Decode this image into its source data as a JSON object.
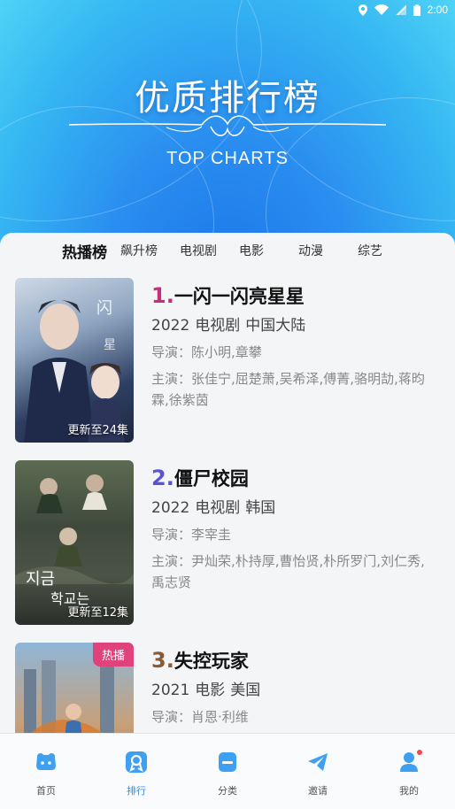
{
  "status": {
    "time": "2:00"
  },
  "hero": {
    "title": "优质排行榜",
    "subtitle": "TOP CHARTS"
  },
  "tabs": [
    {
      "label": "热播榜",
      "active": true
    },
    {
      "label": "飙升榜",
      "active": false
    },
    {
      "label": "电视剧",
      "active": false
    },
    {
      "label": "电影",
      "active": false
    },
    {
      "label": "动漫",
      "active": false
    },
    {
      "label": "综艺",
      "active": false
    }
  ],
  "items": [
    {
      "rank": "1.",
      "rank_color": "#c62f7e",
      "title": "一闪一闪亮星星",
      "year": "2022",
      "type": "电视剧",
      "region": "中国大陆",
      "director": "导演：陈小明,章攀",
      "cast": "主演：张佳宁,屈楚萧,吴希泽,傅菁,骆明劼,蒋昀霖,徐紫茵",
      "episodes": "更新至24集",
      "badge": ""
    },
    {
      "rank": "2.",
      "rank_color": "#5a53d6",
      "title": "僵尸校园",
      "year": "2022",
      "type": "电视剧",
      "region": "韩国",
      "director": "导演：李宰圭",
      "cast": "主演：尹灿荣,朴持厚,曹怡贤,朴所罗门,刘仁秀,禹志贤",
      "episodes": "更新至12集",
      "badge": ""
    },
    {
      "rank": "3.",
      "rank_color": "#8a5a35",
      "title": "失控玩家",
      "year": "2021",
      "type": "电影",
      "region": "美国",
      "director": "导演：肖恩·利维",
      "cast": "",
      "episodes": "",
      "badge": "热播"
    }
  ],
  "nav": [
    {
      "label": "首页",
      "icon": "home-icon",
      "active": false
    },
    {
      "label": "排行",
      "icon": "ranking-icon",
      "active": true
    },
    {
      "label": "分类",
      "icon": "category-icon",
      "active": false
    },
    {
      "label": "邀请",
      "icon": "invite-icon",
      "active": false
    },
    {
      "label": "我的",
      "icon": "profile-icon",
      "active": false,
      "dot": true
    }
  ],
  "colors": {
    "accent": "#2f8bf2",
    "hero_blue": "#2a8ef0",
    "badge_pink": "#e0427c",
    "notify_red": "#f04a4a"
  }
}
